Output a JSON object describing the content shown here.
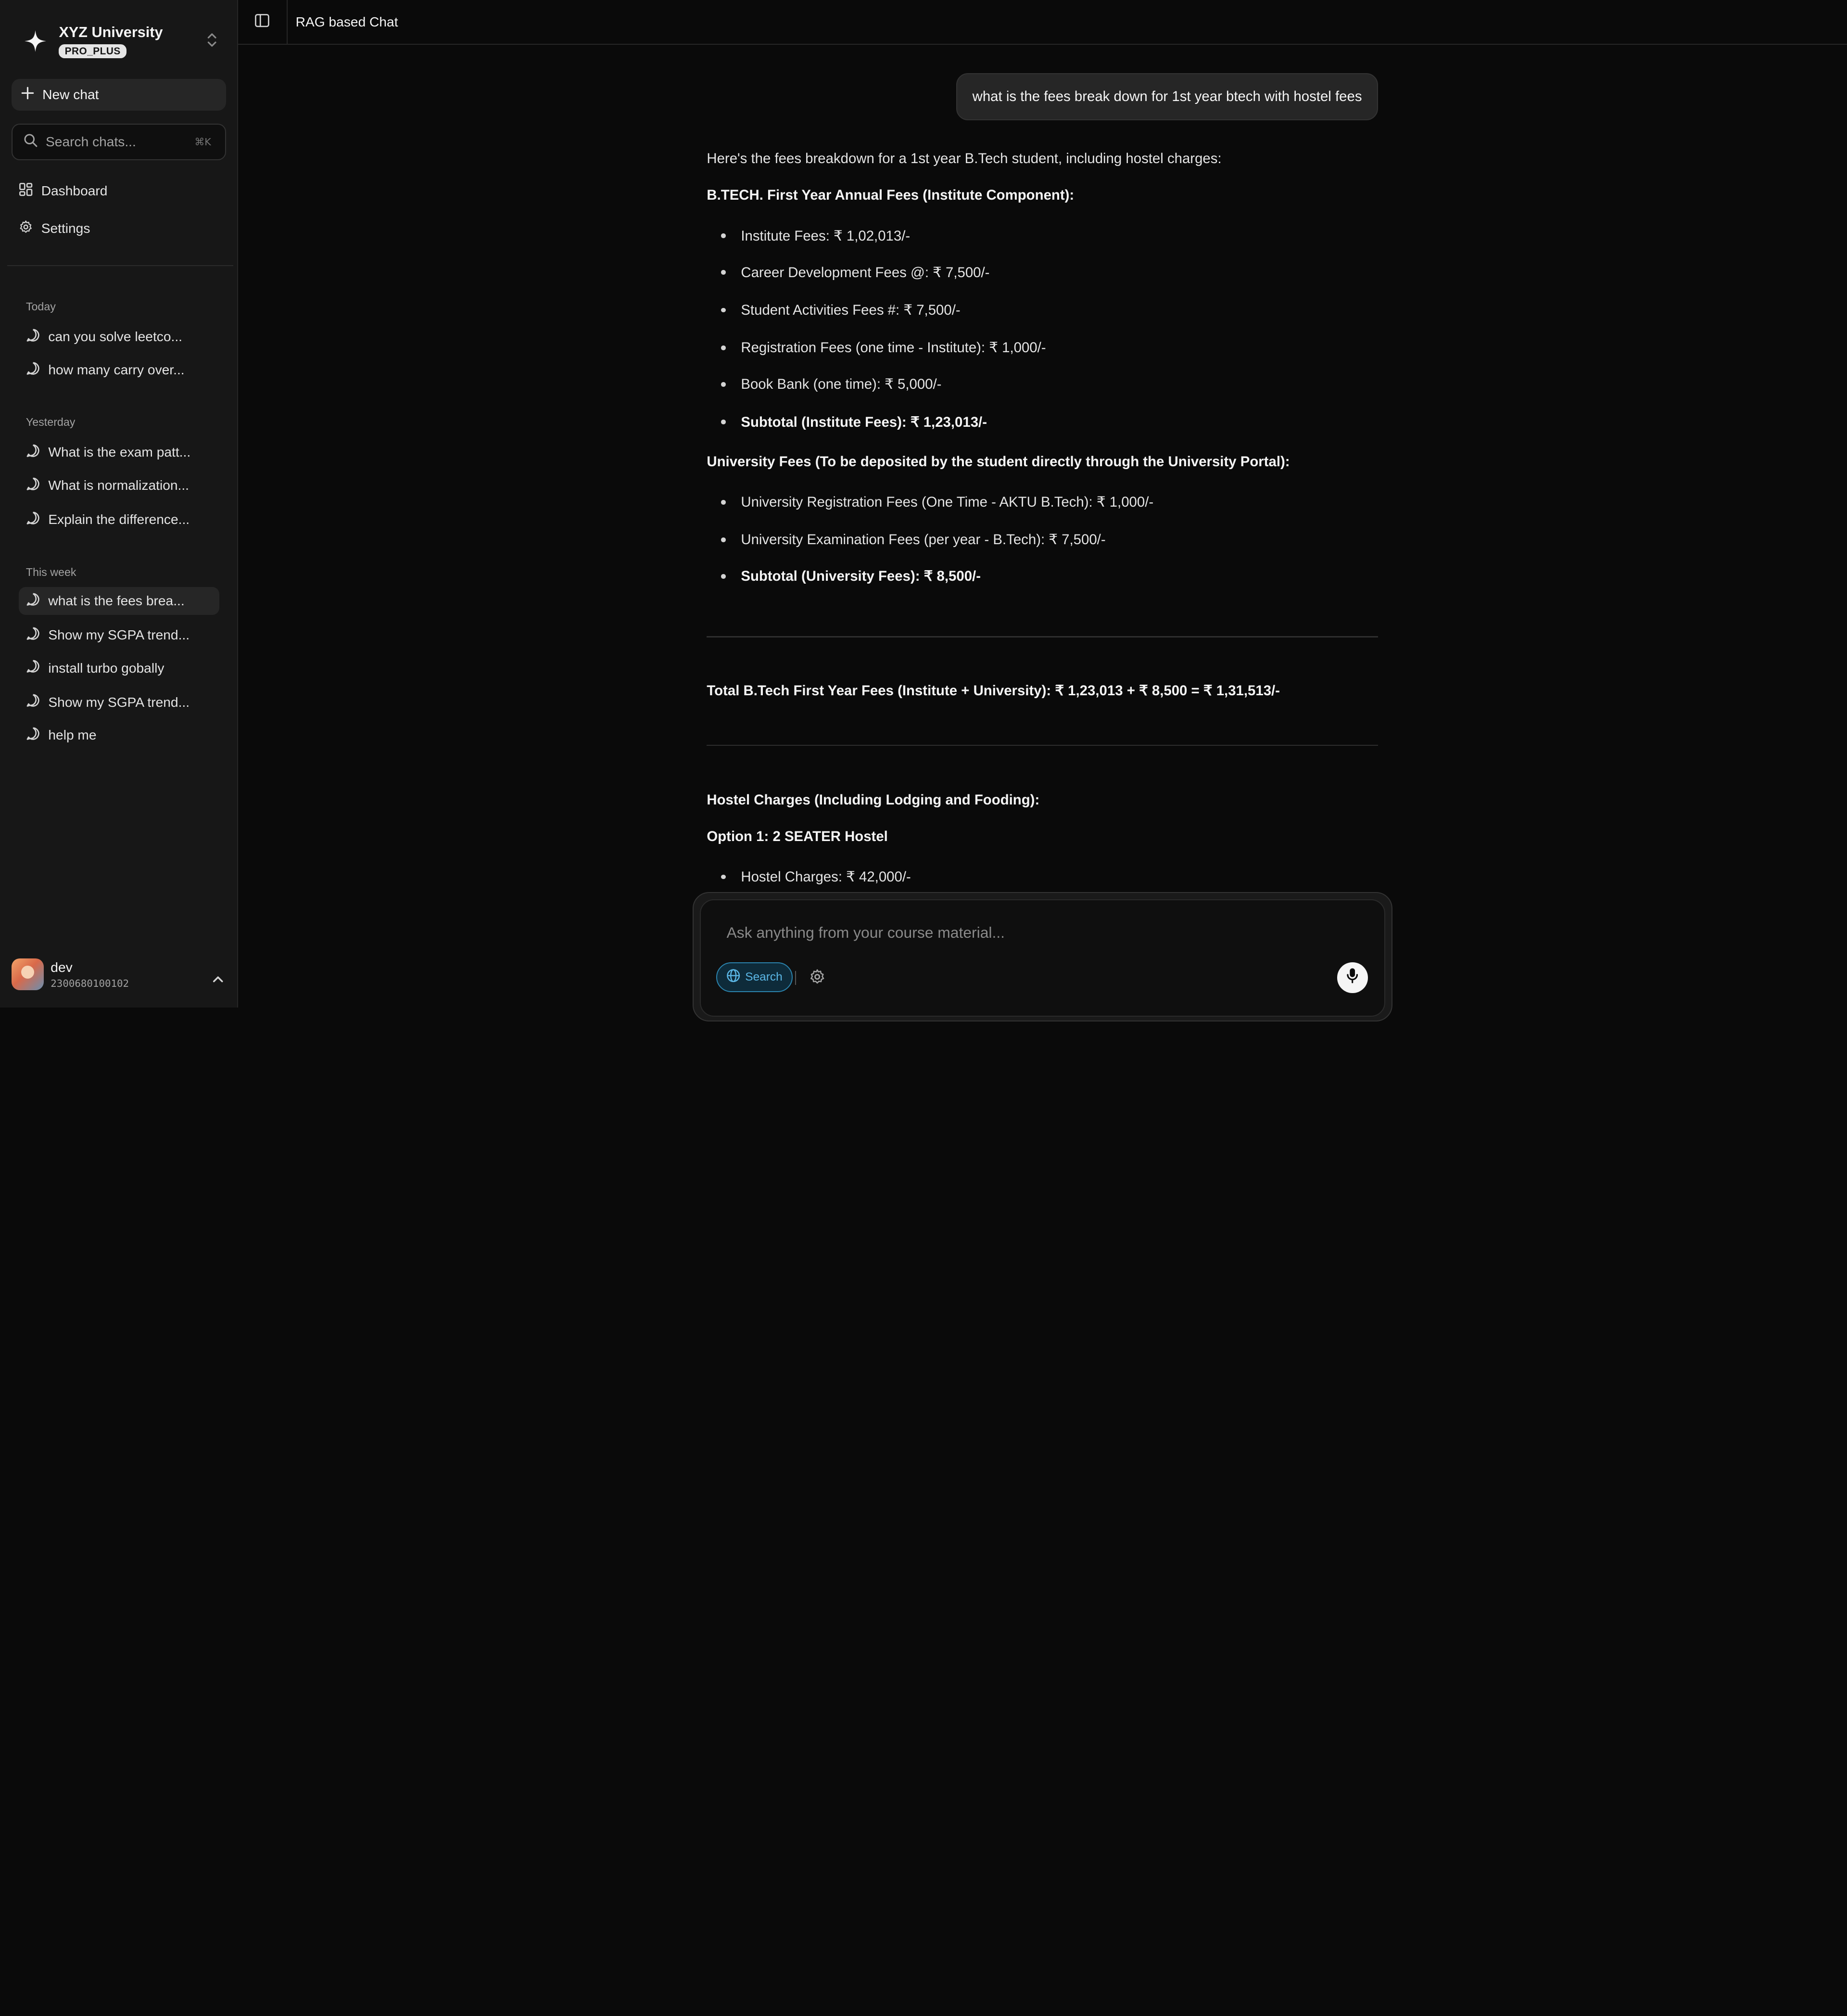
{
  "brand": {
    "name": "XYZ University",
    "badge": "PRO_PLUS"
  },
  "sidebar": {
    "new_chat": "New chat",
    "search": {
      "placeholder": "Search chats...",
      "shortcut": "⌘K"
    },
    "nav": [
      {
        "label": "Dashboard",
        "icon": "dashboard-icon"
      },
      {
        "label": "Settings",
        "icon": "gear-icon"
      }
    ],
    "groups": [
      {
        "label": "Today",
        "items": [
          "can you solve leetco...",
          "how many carry over..."
        ]
      },
      {
        "label": "Yesterday",
        "items": [
          "What is the exam patt...",
          "What is normalization...",
          "Explain the difference..."
        ]
      },
      {
        "label": "This week",
        "items": [
          "what is the fees brea...",
          "Show my SGPA trend...",
          "install turbo gobally",
          "Show my SGPA trend...",
          "help me"
        ]
      }
    ],
    "active_chat": "what is the fees brea..."
  },
  "user": {
    "name": "dev",
    "id": "2300680100102"
  },
  "header": {
    "title": "RAG based Chat"
  },
  "conversation": {
    "user_message": "what is the fees break down for 1st year btech with hostel fees",
    "assistant": {
      "intro": "Here's the fees breakdown for a 1st year B.Tech student, including hostel charges:",
      "section1_title": "B.TECH. First Year Annual Fees (Institute Component):",
      "section1_items": [
        "Institute Fees: ₹ 1,02,013/-",
        "Career Development Fees @: ₹ 7,500/-",
        "Student Activities Fees #: ₹ 7,500/-",
        "Registration Fees (one time - Institute): ₹ 1,000/-",
        "Book Bank (one time): ₹ 5,000/-"
      ],
      "section1_subtotal": "Subtotal (Institute Fees): ₹ 1,23,013/-",
      "section2_title": "University Fees (To be deposited by the student directly through the University Portal):",
      "section2_items": [
        "University Registration Fees (One Time - AKTU B.Tech): ₹ 1,000/-",
        "University Examination Fees (per year - B.Tech): ₹ 7,500/-"
      ],
      "section2_subtotal": "Subtotal (University Fees): ₹ 8,500/-",
      "total": "Total B.Tech First Year Fees (Institute + University): ₹ 1,23,013 + ₹ 8,500 = ₹ 1,31,513/-",
      "hostel_title": "Hostel Charges (Including Lodging and Fooding):",
      "option1_title": "Option 1: 2 SEATER Hostel",
      "option1_items": [
        "Hostel Charges: ₹ 42,000/-"
      ]
    }
  },
  "composer": {
    "placeholder": "Ask anything from your course material...",
    "search_label": "Search"
  },
  "colors": {
    "background": "#0a0a0a",
    "sidebar": "#171717",
    "accent": "#5bb7e6"
  }
}
